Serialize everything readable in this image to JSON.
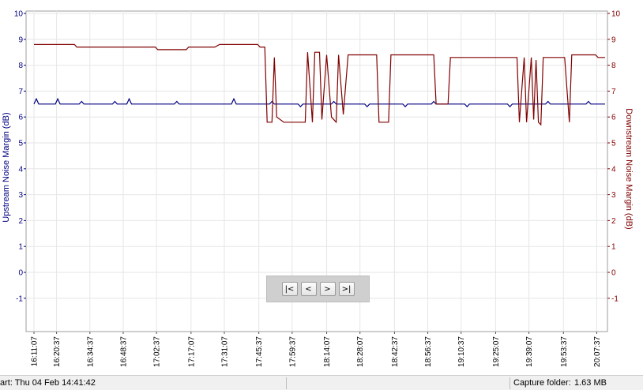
{
  "chart_data": {
    "type": "line",
    "y_left_label": "Upstream Noise Margin (dB)",
    "y_right_label": "Downstream Noise Margin (dB)",
    "y_ticks": [
      10,
      9,
      8,
      7,
      6,
      5,
      4,
      3,
      2,
      1,
      0,
      -1
    ],
    "y_range": [
      -2.2,
      10
    ],
    "x_ticks": [
      "16:11:07",
      "16:20:37",
      "16:34:37",
      "16:48:37",
      "17:02:37",
      "17:17:07",
      "17:31:07",
      "17:45:37",
      "17:59:37",
      "18:14:07",
      "18:28:07",
      "18:42:37",
      "18:56:37",
      "19:10:37",
      "19:25:07",
      "19:39:07",
      "19:53:37",
      "20:07:37"
    ],
    "x_range": [
      "16:11:07",
      "20:11:07"
    ],
    "grid": true,
    "colors": {
      "upstream": "#000080",
      "downstream": "#800000"
    },
    "series": [
      {
        "name": "Upstream Noise Margin (dB)",
        "axis": "left",
        "points": [
          [
            "16:11:07",
            6.5
          ],
          [
            "16:12:07",
            6.7
          ],
          [
            "16:13:07",
            6.5
          ],
          [
            "16:20:07",
            6.5
          ],
          [
            "16:21:07",
            6.7
          ],
          [
            "16:22:07",
            6.5
          ],
          [
            "16:30:07",
            6.5
          ],
          [
            "16:31:07",
            6.6
          ],
          [
            "16:32:07",
            6.5
          ],
          [
            "16:44:07",
            6.5
          ],
          [
            "16:45:07",
            6.6
          ],
          [
            "16:46:07",
            6.5
          ],
          [
            "16:50:07",
            6.5
          ],
          [
            "16:51:07",
            6.7
          ],
          [
            "16:52:07",
            6.5
          ],
          [
            "17:10:07",
            6.5
          ],
          [
            "17:11:07",
            6.6
          ],
          [
            "17:12:07",
            6.5
          ],
          [
            "17:34:07",
            6.5
          ],
          [
            "17:35:07",
            6.7
          ],
          [
            "17:36:07",
            6.5
          ],
          [
            "17:50:07",
            6.5
          ],
          [
            "17:51:07",
            6.6
          ],
          [
            "17:52:07",
            6.5
          ],
          [
            "18:02:07",
            6.5
          ],
          [
            "18:03:07",
            6.4
          ],
          [
            "18:04:07",
            6.5
          ],
          [
            "18:16:07",
            6.5
          ],
          [
            "18:17:07",
            6.6
          ],
          [
            "18:18:07",
            6.5
          ],
          [
            "18:30:07",
            6.5
          ],
          [
            "18:31:07",
            6.4
          ],
          [
            "18:32:07",
            6.5
          ],
          [
            "18:46:07",
            6.5
          ],
          [
            "18:47:07",
            6.4
          ],
          [
            "18:48:07",
            6.5
          ],
          [
            "18:58:07",
            6.5
          ],
          [
            "18:59:07",
            6.6
          ],
          [
            "19:00:07",
            6.5
          ],
          [
            "19:12:07",
            6.5
          ],
          [
            "19:13:07",
            6.4
          ],
          [
            "19:14:07",
            6.5
          ],
          [
            "19:30:07",
            6.5
          ],
          [
            "19:31:07",
            6.4
          ],
          [
            "19:32:07",
            6.5
          ],
          [
            "19:46:07",
            6.5
          ],
          [
            "19:47:07",
            6.6
          ],
          [
            "19:48:07",
            6.5
          ],
          [
            "20:03:07",
            6.5
          ],
          [
            "20:04:07",
            6.6
          ],
          [
            "20:05:07",
            6.5
          ],
          [
            "20:11:07",
            6.5
          ]
        ]
      },
      {
        "name": "Downstream Noise Margin (dB)",
        "axis": "right",
        "points": [
          [
            "16:11:07",
            8.8
          ],
          [
            "16:28:07",
            8.8
          ],
          [
            "16:29:07",
            8.7
          ],
          [
            "16:47:07",
            8.7
          ],
          [
            "17:02:07",
            8.7
          ],
          [
            "17:03:07",
            8.6
          ],
          [
            "17:15:07",
            8.6
          ],
          [
            "17:16:07",
            8.7
          ],
          [
            "17:27:07",
            8.7
          ],
          [
            "17:29:07",
            8.8
          ],
          [
            "17:45:07",
            8.8
          ],
          [
            "17:46:07",
            8.7
          ],
          [
            "17:48:07",
            8.7
          ],
          [
            "17:49:07",
            5.8
          ],
          [
            "17:51:07",
            5.8
          ],
          [
            "17:52:07",
            8.3
          ],
          [
            "17:53:07",
            6.0
          ],
          [
            "17:56:07",
            5.8
          ],
          [
            "18:05:07",
            5.8
          ],
          [
            "18:06:07",
            8.5
          ],
          [
            "18:08:07",
            5.8
          ],
          [
            "18:09:07",
            8.5
          ],
          [
            "18:11:07",
            8.5
          ],
          [
            "18:12:07",
            5.9
          ],
          [
            "18:14:07",
            8.4
          ],
          [
            "18:16:07",
            6.0
          ],
          [
            "18:18:07",
            5.8
          ],
          [
            "18:19:07",
            8.4
          ],
          [
            "18:21:07",
            6.1
          ],
          [
            "18:23:07",
            8.4
          ],
          [
            "18:28:07",
            8.4
          ],
          [
            "18:35:07",
            8.4
          ],
          [
            "18:36:07",
            5.8
          ],
          [
            "18:40:07",
            5.8
          ],
          [
            "18:41:07",
            8.4
          ],
          [
            "18:59:07",
            8.4
          ],
          [
            "19:00:07",
            6.5
          ],
          [
            "19:05:07",
            6.5
          ],
          [
            "19:06:07",
            8.3
          ],
          [
            "19:34:07",
            8.3
          ],
          [
            "19:35:07",
            5.8
          ],
          [
            "19:37:07",
            8.3
          ],
          [
            "19:38:07",
            5.8
          ],
          [
            "19:40:07",
            8.3
          ],
          [
            "19:41:07",
            5.9
          ],
          [
            "19:42:07",
            8.2
          ],
          [
            "19:43:07",
            5.8
          ],
          [
            "19:44:07",
            5.7
          ],
          [
            "19:45:07",
            8.3
          ],
          [
            "19:54:07",
            8.3
          ],
          [
            "19:56:07",
            5.8
          ],
          [
            "19:57:07",
            8.4
          ],
          [
            "20:07:07",
            8.4
          ],
          [
            "20:08:07",
            8.3
          ],
          [
            "20:11:07",
            8.3
          ]
        ]
      }
    ]
  },
  "nav": {
    "first": "|<",
    "prev": "<",
    "next": ">",
    "last": ">|"
  },
  "status": {
    "start": "art: Thu 04 Feb 14:41:42",
    "capture_label": "Capture folder:",
    "capture_size": "1.63 MB"
  }
}
